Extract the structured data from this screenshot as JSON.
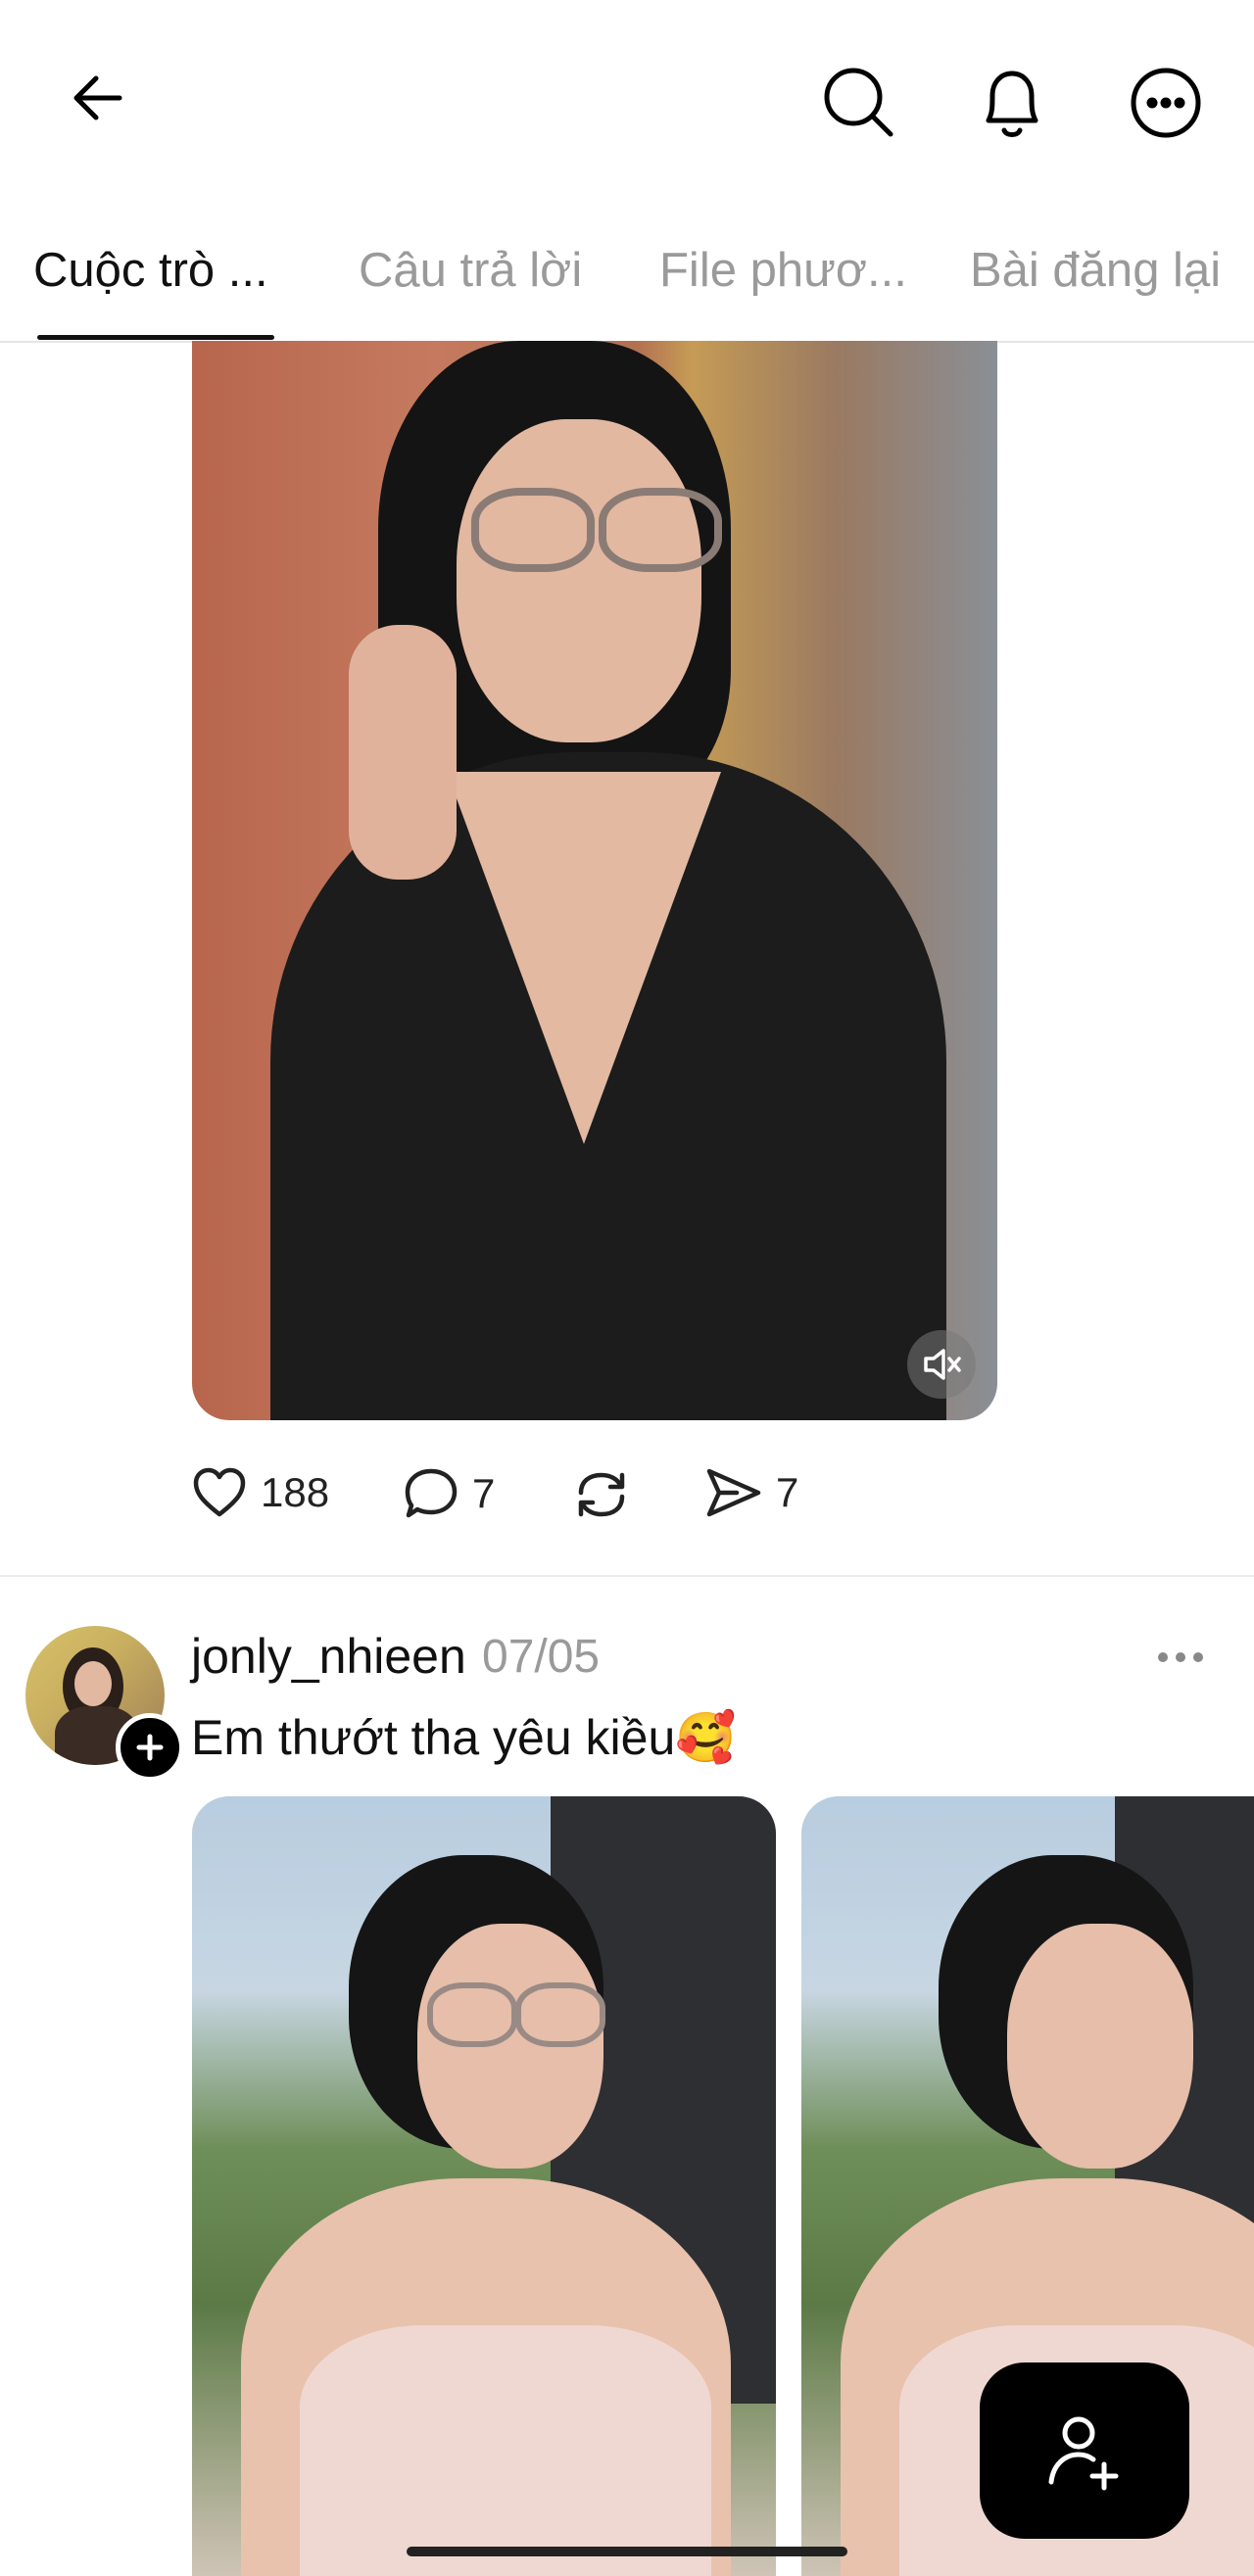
{
  "header": {
    "back_icon": "arrow-left-icon",
    "search_icon": "search-icon",
    "bell_icon": "bell-icon",
    "more_icon": "more-horizontal-icon"
  },
  "tabs": [
    {
      "label": "Cuộc trò ...",
      "active": true
    },
    {
      "label": "Câu trả lời",
      "active": false
    },
    {
      "label": "File phươ...",
      "active": false
    },
    {
      "label": "Bài đăng lại",
      "active": false
    }
  ],
  "post1": {
    "media_description_icon": "muted-speaker-icon",
    "likes": "188",
    "comments": "7",
    "reposts": "",
    "shares": "7"
  },
  "post2": {
    "username": "jonly_nhieen",
    "date": "07/05",
    "caption": "Em thướt tha yêu kiều🥰",
    "more_icon": "more-horizontal-icon"
  },
  "fab_icon": "add-user-icon",
  "colors": {
    "background": "#ffffff",
    "text": "#111111",
    "muted": "#9a9a9a",
    "divider": "#ebebeb"
  }
}
